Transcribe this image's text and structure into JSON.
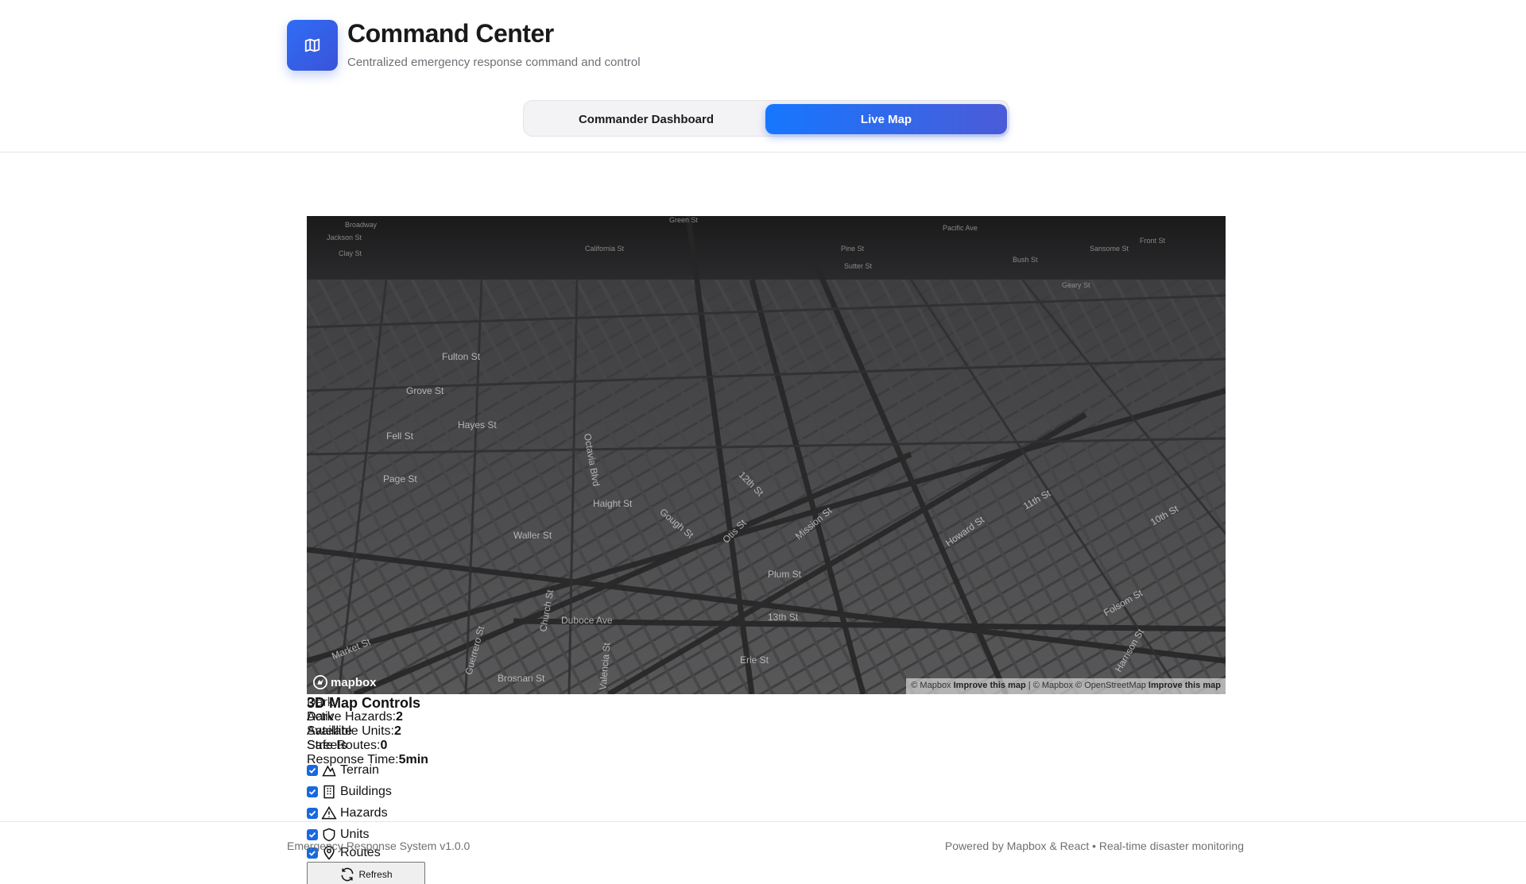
{
  "header": {
    "title": "Command Center",
    "subtitle": "Centralized emergency response command and control",
    "logo_icon": "map-icon",
    "accent": "#2f6df6"
  },
  "tabs": [
    {
      "label": "Commander Dashboard",
      "active": false
    },
    {
      "label": "Live Map",
      "active": true
    }
  ],
  "map": {
    "streets": [
      "Broadway",
      "Jackson St",
      "Clay St",
      "California St",
      "Green St",
      "Pine St",
      "Sutter St",
      "Bush St",
      "Pacific Ave",
      "Front St",
      "Sansome St",
      "Geary St",
      "Fulton St",
      "Grove St",
      "Hayes St",
      "Fell St",
      "Page St",
      "Haight St",
      "Waller St",
      "Market St",
      "Mission St",
      "Howard St",
      "Folsom St",
      "10th St",
      "11th St",
      "12th St",
      "13th St",
      "Duboce Ave",
      "Erie St",
      "Plum St",
      "Octavia Blvd",
      "Gough St",
      "Otis St",
      "Harrison St",
      "Guerrero St",
      "Brosnan St",
      "Church St",
      "Valencia St"
    ],
    "logo_text": "mapbox",
    "attribution": {
      "mapbox": "© Mapbox",
      "improve": "Improve this map",
      "sep": "|",
      "osm": "© Mapbox © OpenStreetMap",
      "improve2": "Improve this map"
    }
  },
  "panel": {
    "title": "3D Map Controls",
    "view_modes": [
      "Dark",
      "Satellite",
      "Streets"
    ],
    "stats": [
      {
        "label": "Active Hazards:",
        "value": "2"
      },
      {
        "label": "Available Units:",
        "value": "2"
      },
      {
        "label": "Safe Routes:",
        "value": "0"
      },
      {
        "label": "Response Time:",
        "value": "5min"
      }
    ],
    "layers": [
      {
        "label": "Terrain",
        "icon": "mountain-icon",
        "checked": true
      },
      {
        "label": "Buildings",
        "icon": "building-icon",
        "checked": true
      },
      {
        "label": "Hazards",
        "icon": "warning-icon",
        "checked": true
      },
      {
        "label": "Units",
        "icon": "shield-icon",
        "checked": true
      },
      {
        "label": "Routes",
        "icon": "map-pin-icon",
        "checked": true
      }
    ],
    "refresh_label": "Refresh"
  },
  "footer": {
    "left": "Emergency Response System v1.0.0",
    "right": "Powered by Mapbox & React • Real-time disaster monitoring"
  }
}
